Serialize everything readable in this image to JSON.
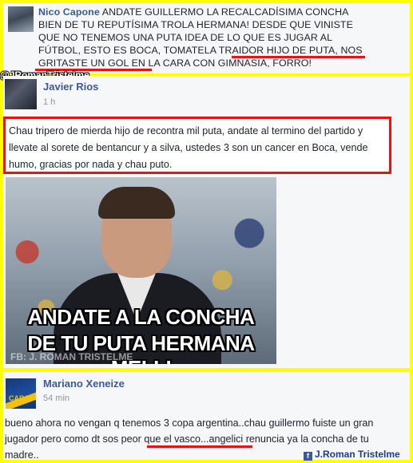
{
  "posts": [
    {
      "author": "Nico Capone",
      "text_lines": [
        "ANDATE GUILLERMO LA RECALCADÍSIMA CONCHA BIEN",
        "DE TU REPUTÍSIMA TROLA HERMANA! DESDE QUE VINISTE QUE NO",
        "TENEMOS UNA PUTA IDEA DE LO QUE ES JUGAR AL FÚTBOL, ESTO ES",
        "BOCA, TOMATELA TRAIDOR HIJO DE PUTA,",
        "NOS GRITASTE UN GOL EN",
        "LA CARA CON GIMNASIA",
        ", FORRO!"
      ]
    },
    {
      "author": "Javier Rios",
      "time": "1 h",
      "text": "Chau tripero de mierda hijo de recontra mil puta, andate al termino del partido y llevate al sorete de bentancur y a silva, ustedes 3 son un cancer en Boca, vende humo, gracias por nada y chau puto.",
      "meme": {
        "caption_1": "ANDATE A LA CONCHA",
        "caption_2": "DE TU PUTA HERMANA MELLI",
        "watermark": "FB: J. ROMAN TRISTELME"
      }
    },
    {
      "author": "Mariano Xeneize",
      "time": "54 min",
      "avatar_text": "CABJ",
      "text_before": "bueno ahora no vengan q tenemos 3 copa argentina..chau guillermo fuiste un gran jugador pero como dt",
      "text_highlight": "sos peor que el vasco",
      "text_after": "...angelici renuncia ya la concha de tu madre.."
    }
  ],
  "watermarks": {
    "top": "@JRomanTristelme",
    "bottom": "J.Roman Tristelme",
    "bottom_icon": "facebook-icon"
  },
  "colors": {
    "frame": "#ffff00",
    "highlight": "#e41515",
    "name": "#3b5998"
  }
}
